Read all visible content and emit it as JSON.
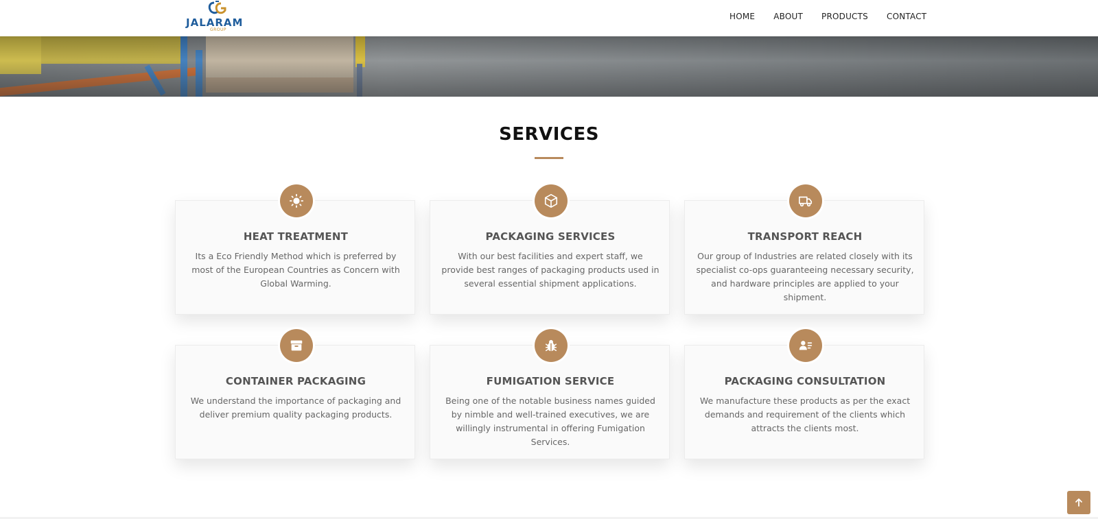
{
  "header": {
    "logo": {
      "word": "JALARAM",
      "sub": "GROUP"
    },
    "nav": [
      {
        "label": "HOME"
      },
      {
        "label": "ABOUT"
      },
      {
        "label": "PRODUCTS"
      },
      {
        "label": "CONTACT"
      }
    ]
  },
  "hero": {
    "image": "warehouse-photo"
  },
  "services": {
    "title": "SERVICES",
    "accent_color": "#b88a5c",
    "items": [
      {
        "icon": "sun-icon",
        "title": "HEAT TREATMENT",
        "text": "Its a Eco Friendly Method which is preferred by most of the European Countries as Concern with Global Warming."
      },
      {
        "icon": "box-icon",
        "title": "PACKAGING SERVICES",
        "text": "With our best facilities and expert staff, we provide best ranges of packaging products used in several essential shipment applications."
      },
      {
        "icon": "truck-icon",
        "title": "TRANSPORT REACH",
        "text": "Our group of Industries are related closely with its specialist co-ops guaranteeing necessary security, and hardware principles are applied to your shipment."
      },
      {
        "icon": "archive-icon",
        "title": "CONTAINER PACKAGING",
        "text": "We understand the importance of packaging and deliver premium quality packaging products."
      },
      {
        "icon": "bug-icon",
        "title": "FUMIGATION SERVICE",
        "text": "Being one of the notable business names guided by nimble and well-trained executives, we are willingly instrumental in offering Fumigation Services."
      },
      {
        "icon": "user-list-icon",
        "title": "PACKAGING CONSULTATION",
        "text": "We manufacture these products as per the exact demands and requirement of the clients which attracts the clients most."
      }
    ]
  },
  "back_to_top": {
    "icon": "arrow-up-icon"
  }
}
